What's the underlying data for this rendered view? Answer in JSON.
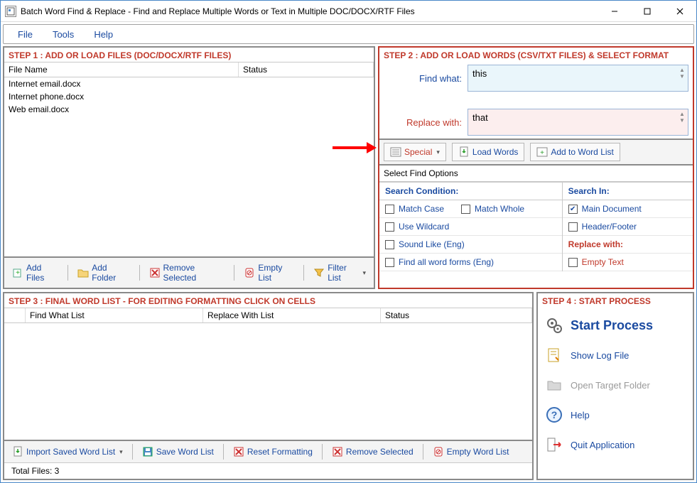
{
  "window": {
    "title": "Batch Word Find & Replace - Find and Replace Multiple Words or Text  in Multiple DOC/DOCX/RTF Files"
  },
  "menu": {
    "file": "File",
    "tools": "Tools",
    "help": "Help"
  },
  "step1": {
    "title": "STEP 1 : ADD OR LOAD FILES (DOC/DOCX/RTF FILES)",
    "col_file": "File Name",
    "col_status": "Status",
    "files": [
      "Internet email.docx",
      "Internet phone.docx",
      "Web email.docx"
    ],
    "toolbar": {
      "add_files": "Add Files",
      "add_folder": "Add Folder",
      "remove_selected": "Remove Selected",
      "empty_list": "Empty List",
      "filter_list": "Filter List"
    }
  },
  "step2": {
    "title": "STEP 2 : ADD OR LOAD WORDS (CSV/TXT FILES) & SELECT FORMAT",
    "find_label": "Find what:",
    "find_value": "this",
    "replace_label": "Replace with:",
    "replace_value": "that",
    "toolbar": {
      "special": "Special",
      "load_words": "Load Words",
      "add_to_list": "Add to Word List"
    },
    "options_title": "Select Find Options",
    "search_condition_head": "Search Condition:",
    "search_in_head": "Search In:",
    "replace_with_head": "Replace with:",
    "opts": {
      "match_case": "Match Case",
      "match_whole": "Match Whole",
      "use_wildcard": "Use Wildcard",
      "sound_like": "Sound Like (Eng)",
      "find_all": "Find all word forms (Eng)",
      "main_doc": "Main Document",
      "header_footer": "Header/Footer",
      "empty_text": "Empty Text"
    }
  },
  "step3": {
    "title": "STEP 3 : FINAL WORD LIST - FOR EDITING FORMATTING CLICK ON CELLS",
    "col_find": "Find What List",
    "col_replace": "Replace With List",
    "col_status": "Status",
    "toolbar": {
      "import": "Import Saved Word List",
      "save": "Save Word List",
      "reset": "Reset Formatting",
      "remove": "Remove Selected",
      "empty": "Empty Word List"
    },
    "total_files_label": "Total Files: 3"
  },
  "step4": {
    "title": "STEP 4 : START PROCESS",
    "start": "Start Process",
    "show_log": "Show Log File",
    "open_target": "Open Target Folder",
    "help": "Help",
    "quit": "Quit Application"
  }
}
